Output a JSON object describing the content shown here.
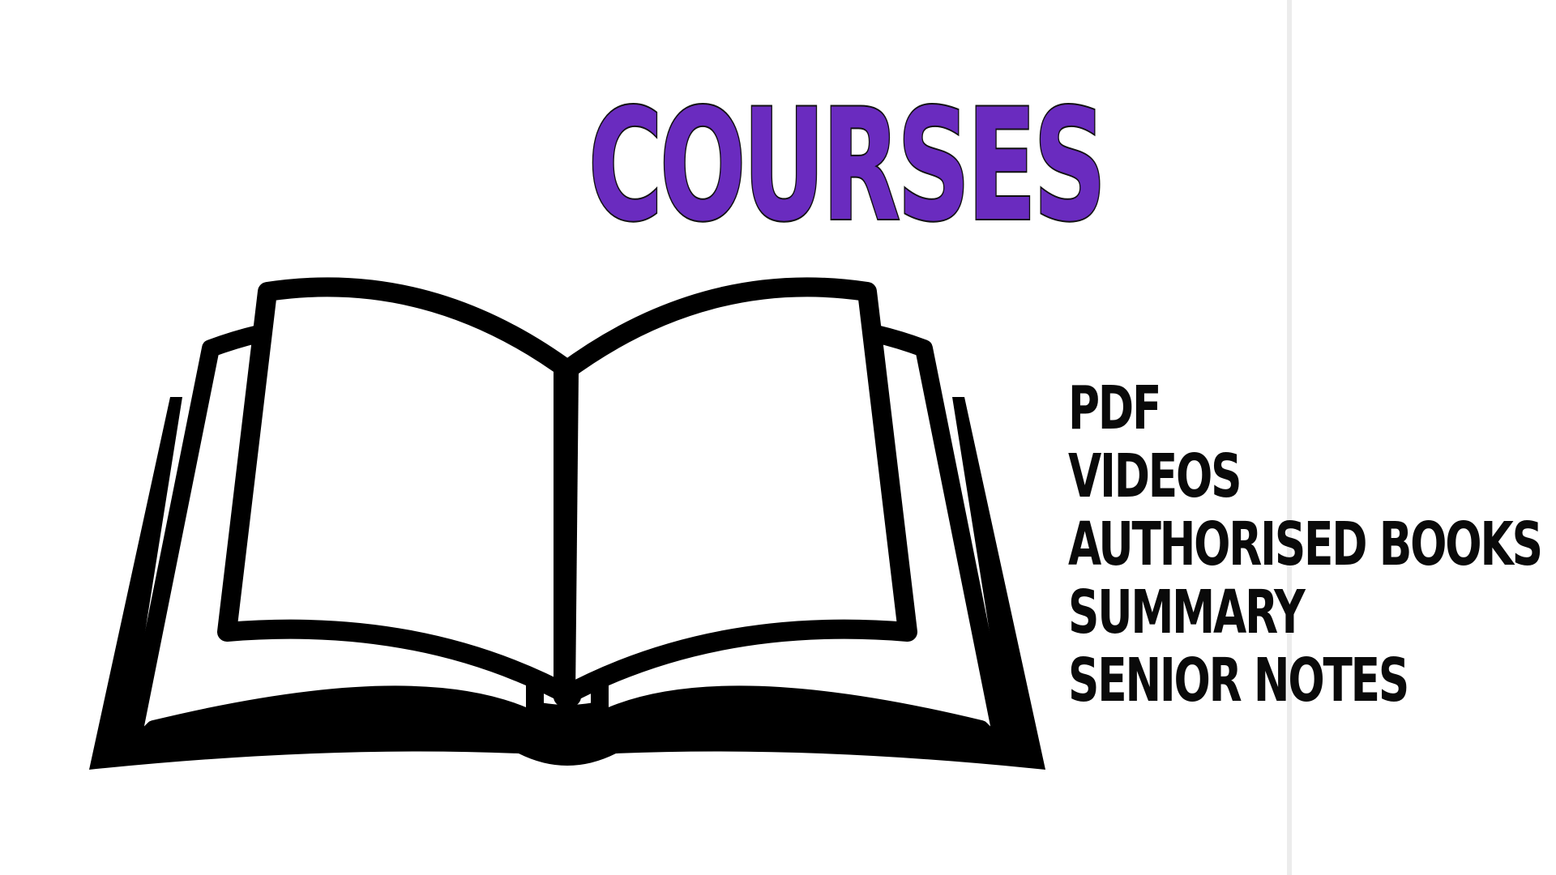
{
  "title": {
    "text": "COURSES",
    "color": "#6a2bbf",
    "outline_color": "#111111"
  },
  "illustration": {
    "icon": "open-book-icon",
    "stroke_color": "#000000",
    "fill_color": "#ffffff"
  },
  "items": [
    {
      "label": "PDF"
    },
    {
      "label": "VIDEOS"
    },
    {
      "label": "AUTHORISED BOOKS"
    },
    {
      "label": "SUMMARY"
    },
    {
      "label": "SENIOR NOTES"
    }
  ]
}
